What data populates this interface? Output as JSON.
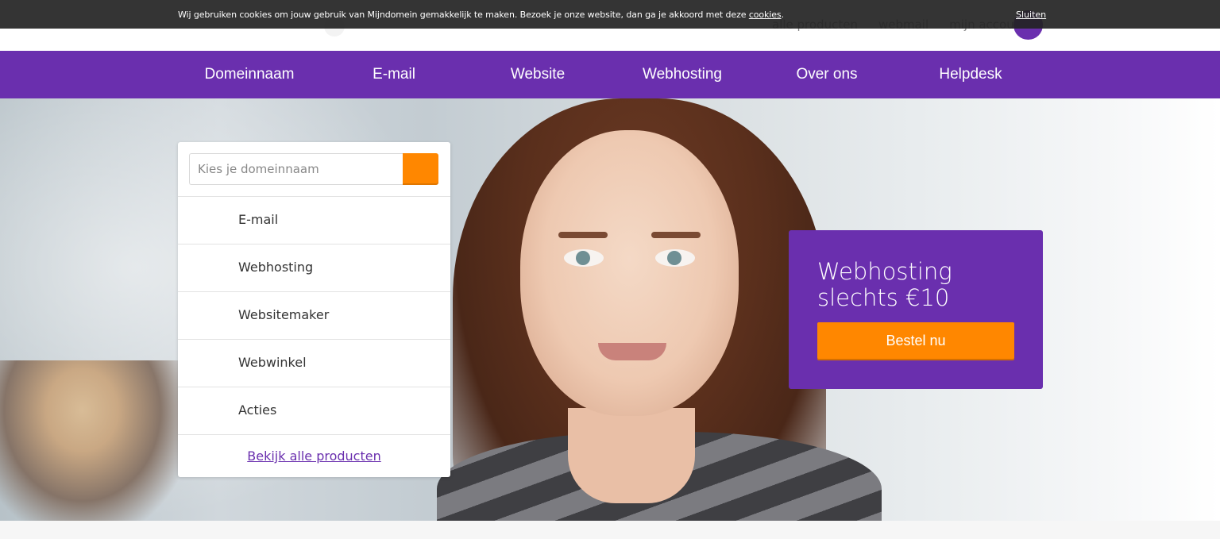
{
  "cookie_bar": {
    "text": "Wij gebruiken cookies om jouw gebruik van Mijndomein gemakkelijk te maken. Bezoek je onze website, dan ga je akkoord met deze ",
    "link": "cookies",
    "suffix": ".",
    "close": "Sluiten"
  },
  "header": {
    "links": [
      "alle producten",
      "webmail",
      "mijn account"
    ]
  },
  "nav": {
    "items": [
      "Domeinnaam",
      "E-mail",
      "Website",
      "Webhosting",
      "Over ons",
      "Helpdesk"
    ]
  },
  "search": {
    "placeholder": "Kies je domeinnaam"
  },
  "product_menu": {
    "items": [
      "E-mail",
      "Webhosting",
      "Websitemaker",
      "Webwinkel",
      "Acties"
    ],
    "all_products": "Bekijk alle producten"
  },
  "promo": {
    "title": "Webhosting slechts €10",
    "button": "Bestel nu"
  },
  "colors": {
    "brand_purple": "#6a2fae",
    "accent_orange": "#ff8700"
  }
}
